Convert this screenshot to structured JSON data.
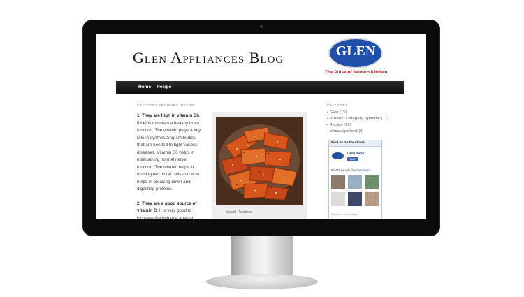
{
  "blog": {
    "title": "Glen Appliances Blog",
    "logo_text": "GLEN",
    "tagline": "The Pulse of Modern Kitchen"
  },
  "nav": {
    "items": [
      "Home",
      "Recipe"
    ]
  },
  "archive_label": "CATEGORY ARCHIVES: RECIPE",
  "post": {
    "p1_bold": "1.  They are high in vitamin B6",
    "p1_rest": ". It helps maintain a healthy brain function. The vitamin plays a key role in synthesizing antibodies that are needed to fight various diseases. Vitamin B6 helps in maintaining normal nerve function. The vitamin helps in forming red blood cells and also helps in breaking down and digesting proteins.",
    "p2_bold": "2. They are a good source of vitamin C",
    "p2_rest": ". It is very good to increase the immune against cold",
    "image_caption": "Sweet Potatoes"
  },
  "sidebar": {
    "heading": "CATEGORY",
    "categories": [
      {
        "name": "Glen",
        "count": "(15)"
      },
      {
        "name": "Product Category Specific",
        "count": "(17)"
      },
      {
        "name": "Recipe",
        "count": "(26)"
      },
      {
        "name": "Uncategorized",
        "count": "(8)"
      }
    ],
    "facebook": {
      "header": "Find us on Facebook",
      "page_name": "Glen India",
      "like_label": "Like",
      "people_count": "68,465 people like",
      "people_link": "Glen India",
      "footer": "Facebook social plugin"
    }
  },
  "colors": {
    "brand_blue": "#1f4fa8",
    "brand_red": "#c8161d",
    "nav_bg": "#1a1a1a"
  }
}
